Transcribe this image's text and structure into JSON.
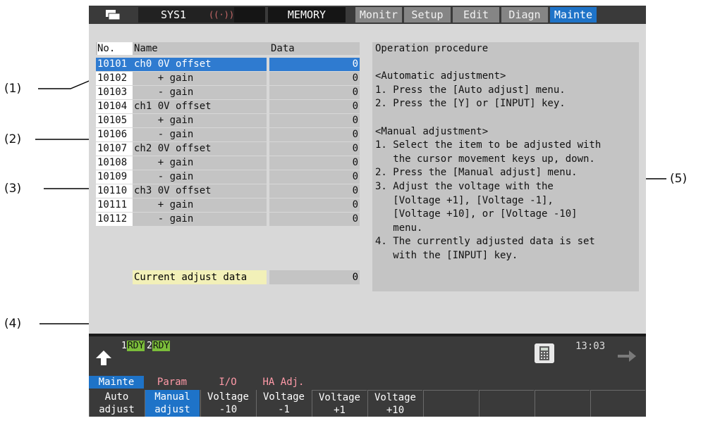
{
  "callouts": [
    "(1)",
    "(2)",
    "(3)",
    "(4)",
    "(5)"
  ],
  "topbar": {
    "system": "SYS1",
    "signal": "((·))",
    "mode": "MEMORY",
    "tabs": [
      "Monitr",
      "Setup",
      "Edit",
      "Diagn",
      "Mainte"
    ],
    "active_tab": "Mainte"
  },
  "table": {
    "headers": {
      "no": "No.",
      "name": "Name",
      "data": "Data"
    },
    "rows": [
      {
        "no": "10101",
        "name": "ch0 0V offset",
        "data": "0"
      },
      {
        "no": "10102",
        "name": "    + gain",
        "data": "0"
      },
      {
        "no": "10103",
        "name": "    - gain",
        "data": "0"
      },
      {
        "no": "10104",
        "name": "ch1 0V offset",
        "data": "0"
      },
      {
        "no": "10105",
        "name": "    + gain",
        "data": "0"
      },
      {
        "no": "10106",
        "name": "    - gain",
        "data": "0"
      },
      {
        "no": "10107",
        "name": "ch2 0V offset",
        "data": "0"
      },
      {
        "no": "10108",
        "name": "    + gain",
        "data": "0"
      },
      {
        "no": "10109",
        "name": "    - gain",
        "data": "0"
      },
      {
        "no": "10110",
        "name": "ch3 0V offset",
        "data": "0"
      },
      {
        "no": "10111",
        "name": "    + gain",
        "data": "0"
      },
      {
        "no": "10112",
        "name": "    - gain",
        "data": "0"
      }
    ],
    "selected_row": 0
  },
  "current_adjust": {
    "label": "Current adjust data",
    "value": "0"
  },
  "procedure": [
    "Operation procedure",
    "",
    "<Automatic adjustment>",
    "1. Press the [Auto adjust] menu.",
    "2. Press the [Y] or [INPUT] key.",
    "",
    "<Manual adjustment>",
    "1. Select the item to be adjusted with",
    "   the cursor movement keys up, down.",
    "2. Press the [Manual adjust] menu.",
    "3. Adjust the voltage with the",
    "   [Voltage +1], [Voltage -1],",
    "   [Voltage +10], or [Voltage -10]",
    "   menu.",
    "4. The currently adjusted data is set",
    "   with the [INPUT] key."
  ],
  "status": {
    "rdy1_num": "1",
    "rdy1": "RDY",
    "rdy2_num": "2",
    "rdy2": "RDY",
    "time": "13:03"
  },
  "menu": {
    "tabs": [
      {
        "label": "Mainte",
        "color": "#ffffff",
        "bg": "#1e73c8"
      },
      {
        "label": "Param",
        "color": "#ff9aa8",
        "bg": ""
      },
      {
        "label": "I/O",
        "color": "#ff9aa8",
        "bg": ""
      },
      {
        "label": "HA Adj.",
        "color": "#ff9aa8",
        "bg": ""
      }
    ],
    "keys": [
      {
        "label": "Auto\nadjust",
        "highlight": false
      },
      {
        "label": "Manual\nadjust",
        "highlight": true
      },
      {
        "label": "Voltage\n-10",
        "highlight": false
      },
      {
        "label": "Voltage\n-1",
        "highlight": false
      },
      {
        "label": "Voltage\n+1",
        "highlight": false
      },
      {
        "label": "Voltage\n+10",
        "highlight": false
      },
      {
        "label": "",
        "highlight": false
      },
      {
        "label": "",
        "highlight": false
      },
      {
        "label": "",
        "highlight": false
      },
      {
        "label": "",
        "highlight": false
      }
    ]
  }
}
